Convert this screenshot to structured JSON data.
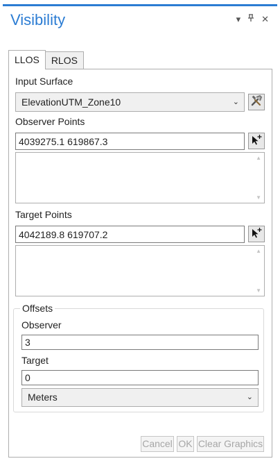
{
  "window": {
    "title": "Visibility",
    "controls": [
      "▾",
      "⊓",
      "✕"
    ]
  },
  "tabs": [
    {
      "label": "LLOS",
      "active": true
    },
    {
      "label": "RLOS",
      "active": false
    }
  ],
  "input_surface": {
    "label": "Input Surface",
    "value": "ElevationUTM_Zone10"
  },
  "observer_points": {
    "label": "Observer Points",
    "value": "4039275.1 619867.3"
  },
  "target_points": {
    "label": "Target Points",
    "value": "4042189.8 619707.2"
  },
  "offsets": {
    "title": "Offsets",
    "observer_label": "Observer",
    "observer_value": "3",
    "target_label": "Target",
    "target_value": "0",
    "unit": "Meters"
  },
  "buttons": {
    "cancel": "Cancel",
    "ok": "OK",
    "clear": "Clear Graphics"
  },
  "colors": {
    "accent": "#2b7cd3",
    "disabled_text": "#a6a6a6"
  },
  "icons": {
    "surface_tool": "hammer-wrench-icon",
    "map_point_tool": "cursor-plus-icon"
  }
}
